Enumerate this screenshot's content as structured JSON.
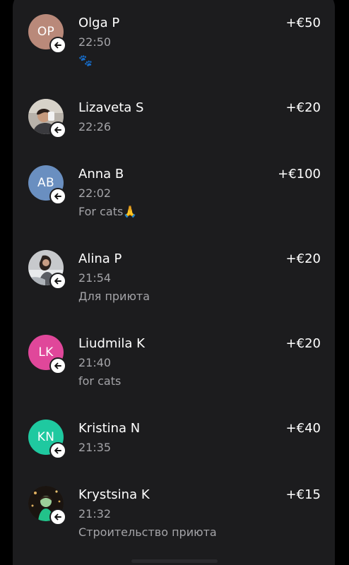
{
  "transactions": [
    {
      "initials": "OP",
      "name": "Olga P",
      "time": "22:50",
      "note": "🐾",
      "amount": "+€50",
      "avatar_color": "#b9897a",
      "avatar_type": "initials"
    },
    {
      "initials": "",
      "name": "Lizaveta S",
      "time": "22:26",
      "note": "",
      "amount": "+€20",
      "avatar_color": "#8a8a8a",
      "avatar_type": "photo"
    },
    {
      "initials": "AB",
      "name": "Anna B",
      "time": "22:02",
      "note": "For cats🙏",
      "amount": "+€100",
      "avatar_color": "#6a8fc0",
      "avatar_type": "initials"
    },
    {
      "initials": "",
      "name": "Alina P",
      "time": "21:54",
      "note": "Для приюта",
      "amount": "+€20",
      "avatar_color": "#9a9a9a",
      "avatar_type": "photo"
    },
    {
      "initials": "LK",
      "name": "Liudmila K",
      "time": "21:40",
      "note": "for cats",
      "amount": "+€20",
      "avatar_color": "#e0479a",
      "avatar_type": "initials"
    },
    {
      "initials": "KN",
      "name": "Kristina N",
      "time": "21:35",
      "note": "",
      "amount": "+€40",
      "avatar_color": "#1fc9a0",
      "avatar_type": "initials"
    },
    {
      "initials": "",
      "name": "Krystsina K",
      "time": "21:32",
      "note": "Строительство приюта",
      "amount": "+€15",
      "avatar_color": "#2a2a2a",
      "avatar_type": "photo"
    }
  ],
  "incoming_badge_icon": "arrow-left-icon"
}
